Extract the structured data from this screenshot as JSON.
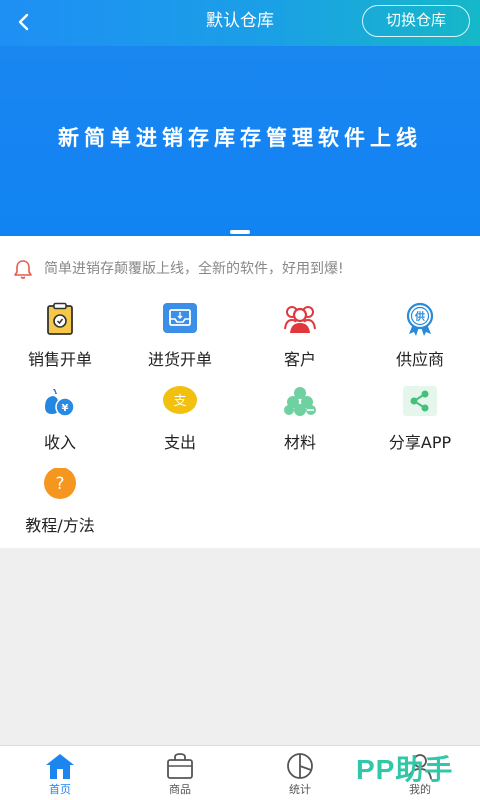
{
  "header": {
    "title": "默认仓库",
    "switch_label": "切换仓库"
  },
  "banner": {
    "text": "新简单进销存库存管理软件上线"
  },
  "notice": {
    "text": "简单进销存颠覆版上线，全新的软件，好用到爆!"
  },
  "grid": [
    {
      "label": "销售开单",
      "icon": "clipboard-icon"
    },
    {
      "label": "进货开单",
      "icon": "inbox-icon"
    },
    {
      "label": "客户",
      "icon": "people-icon"
    },
    {
      "label": "供应商",
      "icon": "supplier-badge-icon"
    },
    {
      "label": "收入",
      "icon": "money-bag-icon"
    },
    {
      "label": "支出",
      "icon": "expense-coin-icon"
    },
    {
      "label": "材料",
      "icon": "materials-cloud-icon"
    },
    {
      "label": "分享APP",
      "icon": "share-icon"
    },
    {
      "label": "教程/方法",
      "icon": "question-icon"
    }
  ],
  "icon_texts": {
    "supplier": "供",
    "expense": "支",
    "question": "?"
  },
  "tabs": [
    {
      "label": "首页",
      "icon": "home-icon",
      "active": true
    },
    {
      "label": "商品",
      "icon": "bag-icon",
      "active": false
    },
    {
      "label": "统计",
      "icon": "pie-chart-icon",
      "active": false
    },
    {
      "label": "我的",
      "icon": "user-icon",
      "active": false
    }
  ],
  "watermark": "PP助手",
  "colors": {
    "primary": "#1b86f0",
    "header_end": "#15b8c8",
    "watermark": "#30c8a8"
  }
}
